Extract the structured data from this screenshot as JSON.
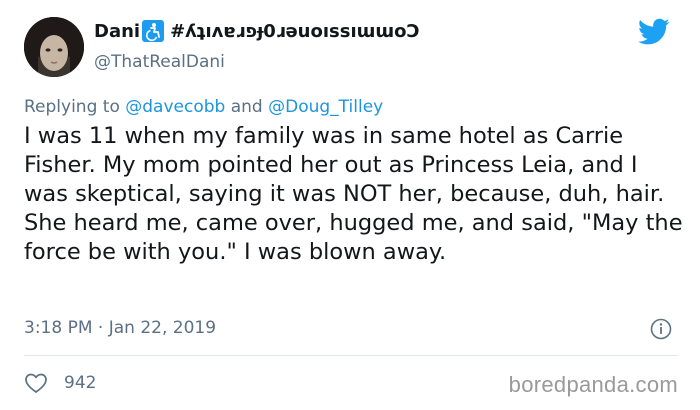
{
  "tweet": {
    "display_name": "Dani",
    "name_suffix": "#ʎʇıʌɐɹפɟ0ɹǝuoıssıɯɯoƆ",
    "handle": "@ThatRealDani",
    "replying_prefix": "Replying to ",
    "replying_to_1": "@davecobb",
    "replying_and": " and ",
    "replying_to_2": "@Doug_Tilley",
    "text": "I was 11 when my family was in same hotel as Carrie Fisher. My mom pointed her out as Princess Leia, and I was skeptical, saying it was NOT her, because, duh, hair. She heard me, came over, hugged me, and said, \"May the force be with you.\" I was blown away.",
    "time": "3:18 PM · Jan 22, 2019",
    "likes": "942"
  },
  "icons": {
    "brand": "twitter-bird-icon",
    "name_badge": "accessibility-icon",
    "info": "info-icon",
    "like": "heart-icon"
  },
  "colors": {
    "twitter_blue": "#1da1f2",
    "mention_blue": "#1b95e0",
    "secondary_text": "#5b7083"
  },
  "watermark": "boredpanda.com"
}
